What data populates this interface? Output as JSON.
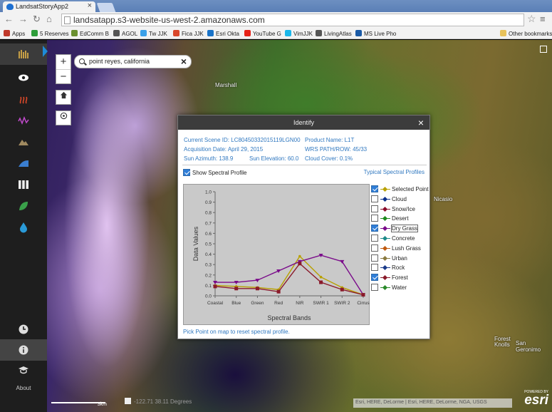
{
  "browser": {
    "tab_title": "LandsatStoryApp2",
    "tab_close": "×",
    "url": "landsatapp.s3-website-us-west-2.amazonaws.com",
    "bookmarks": [
      {
        "label": "Apps",
        "color": "#c0392b"
      },
      {
        "label": "5 Reserves",
        "color": "#2e9d3a"
      },
      {
        "label": "EdComm B",
        "color": "#6a8f2f"
      },
      {
        "label": "AGOL",
        "color": "#555555"
      },
      {
        "label": "Tw JJK",
        "color": "#3aa0e8"
      },
      {
        "label": "Fica JJK",
        "color": "#d9472b"
      },
      {
        "label": "Esri Okta",
        "color": "#1a73c8"
      },
      {
        "label": "YouTube G",
        "color": "#e62117"
      },
      {
        "label": "VimJJK",
        "color": "#1ab7ea"
      },
      {
        "label": "LivingAtlas",
        "color": "#555555"
      },
      {
        "label": "MS Live Pho",
        "color": "#1a5aa6"
      }
    ],
    "other_bookmarks": "Other bookmarks"
  },
  "map": {
    "search_value": "point reyes, california",
    "zoom_in": "+",
    "zoom_out": "−",
    "labels": [
      {
        "text": "Marshall"
      },
      {
        "text": "Nicasio"
      },
      {
        "text": "Forest Knolls"
      },
      {
        "text": "San Geronimo"
      }
    ],
    "scale_label": "3km",
    "coordinates": "-122.71 38.11 Degrees",
    "attribution": "Esri, HERE, DeLorme | Esri, HERE, DeLorme, NGA, USGS",
    "esri_powered": "POWERED BY",
    "esri_name": "esri"
  },
  "sidebar": {
    "about_label": "About"
  },
  "identify": {
    "title": "Identify",
    "close": "×",
    "scene_id": "Current Scene ID: LC80450332015119LGN00",
    "product_name": "Product Name: L1T",
    "acq_date": "Acquisition Date: April 29, 2015",
    "wrs": "WRS PATH/ROW: 45/33",
    "sun_azimuth": "Sun Azimuth: 138.9",
    "sun_elevation": "Sun Elevation: 60.0",
    "cloud_cover": "Cloud Cover: 0.1%",
    "show_spectral": "Show Spectral Profile",
    "typical_link": "Typical Spectral Profiles",
    "pick_hint": "Pick Point on map to reset spectral profile.",
    "legend": [
      {
        "label": "Selected Point",
        "color": "#b8a000",
        "checked": true
      },
      {
        "label": "Cloud",
        "color": "#0b2f8a",
        "checked": false
      },
      {
        "label": "Snow/Ice",
        "color": "#8a0b2a",
        "checked": false
      },
      {
        "label": "Desert",
        "color": "#1e8a1e",
        "checked": false
      },
      {
        "label": "Dry Grass",
        "color": "#7a0b8a",
        "checked": true
      },
      {
        "label": "Concrete",
        "color": "#1e8a8a",
        "checked": false
      },
      {
        "label": "Lush Grass",
        "color": "#c05a10",
        "checked": false
      },
      {
        "label": "Urban",
        "color": "#8a7a40",
        "checked": false
      },
      {
        "label": "Rock",
        "color": "#1a3a8a",
        "checked": false
      },
      {
        "label": "Forest",
        "color": "#8a1a2a",
        "checked": true
      },
      {
        "label": "Water",
        "color": "#2a8a2a",
        "checked": false
      }
    ]
  },
  "chart_data": {
    "type": "line",
    "xlabel": "Spectral Bands",
    "ylabel": "Data Values",
    "categories": [
      "Coastal",
      "Blue",
      "Green",
      "Red",
      "NIR",
      "SWIR 1",
      "SWIR 2",
      "Cirrus"
    ],
    "ylim": [
      0,
      1.0
    ],
    "yticks": [
      "0.0",
      "0.1",
      "0.2",
      "0.3",
      "0.4",
      "0.5",
      "0.6",
      "0.7",
      "0.8",
      "0.9",
      "1.0"
    ],
    "series": [
      {
        "name": "Selected Point",
        "color": "#b8a000",
        "values": [
          0.1,
          0.09,
          0.08,
          0.06,
          0.38,
          0.18,
          0.08,
          0.01
        ]
      },
      {
        "name": "Dry Grass",
        "color": "#7a0b8a",
        "values": [
          0.13,
          0.13,
          0.15,
          0.24,
          0.33,
          0.39,
          0.33,
          0.01
        ]
      },
      {
        "name": "Forest",
        "color": "#8a1a2a",
        "values": [
          0.09,
          0.07,
          0.07,
          0.04,
          0.31,
          0.13,
          0.06,
          0.01
        ]
      }
    ]
  }
}
